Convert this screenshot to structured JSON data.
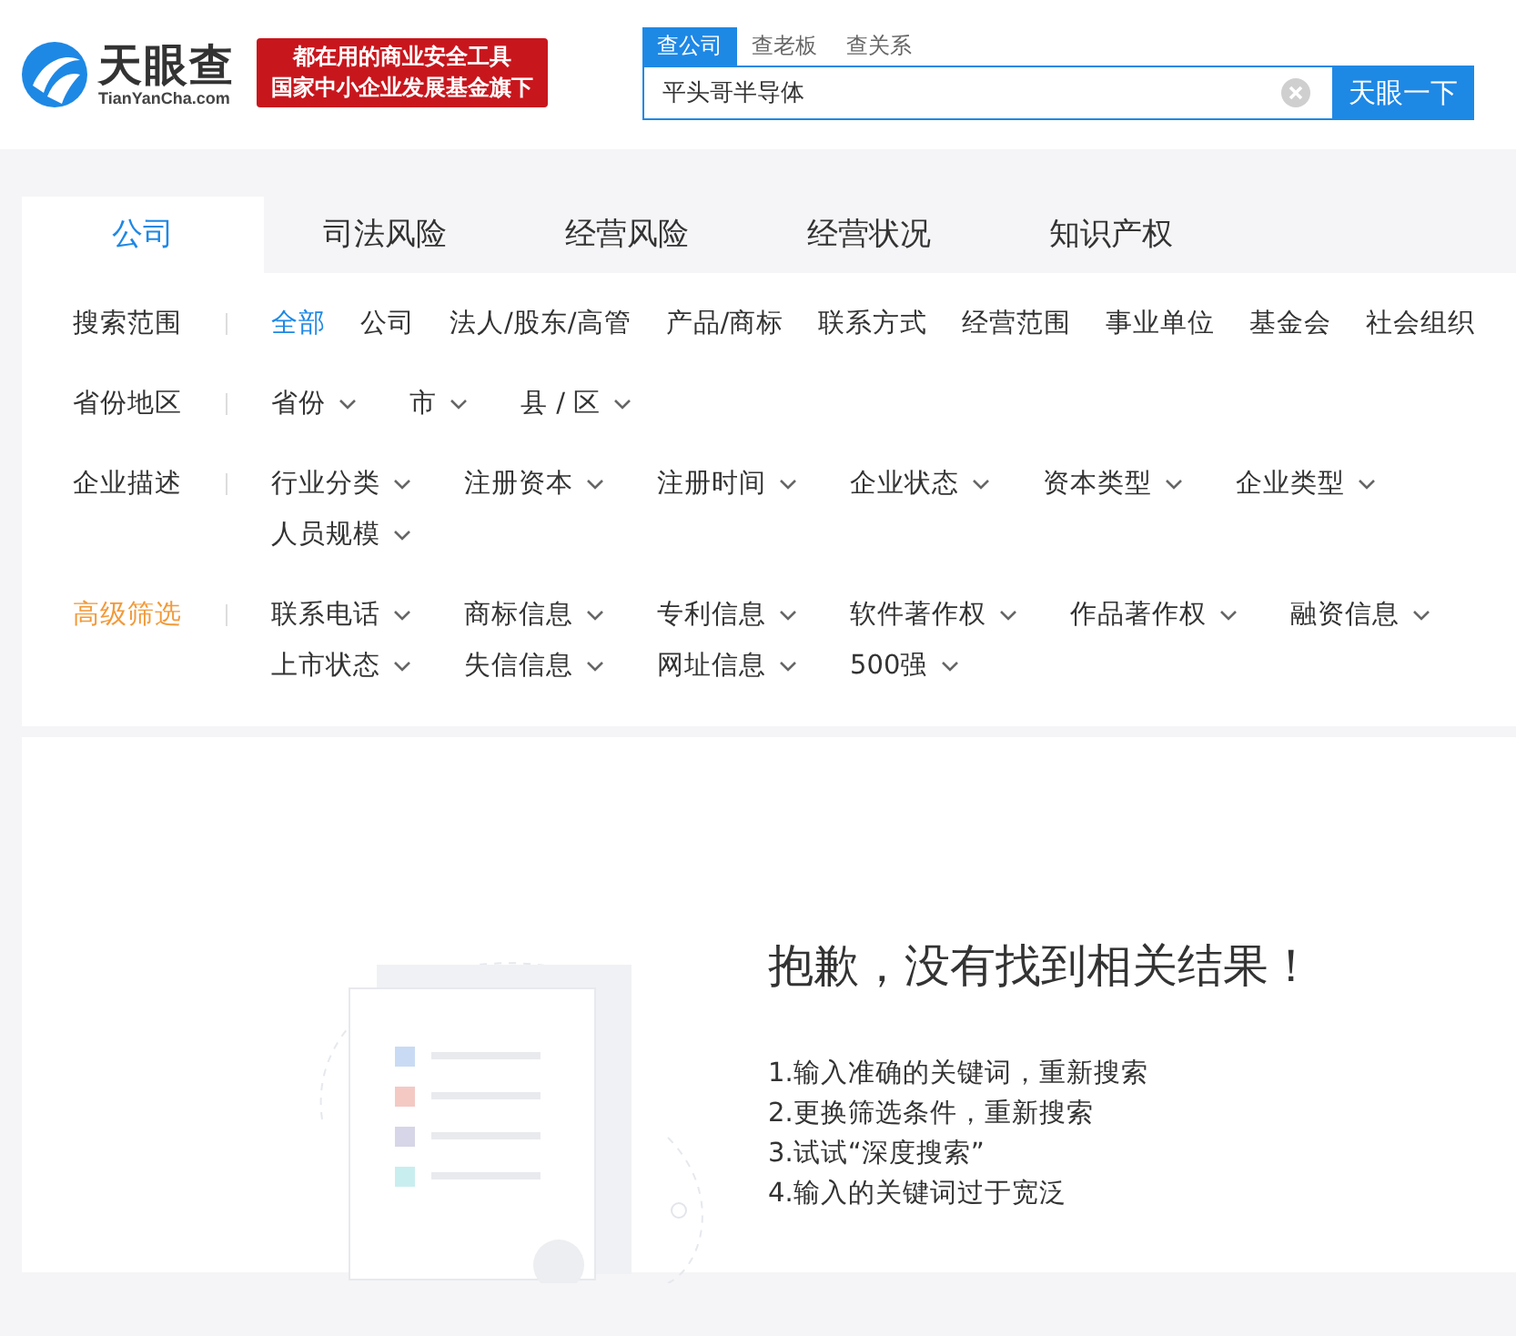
{
  "header": {
    "logo": {
      "name": "天眼查",
      "domain": "TianYanCha.com"
    },
    "banner": [
      "都在用的商业安全工具",
      "国家中小企业发展基金旗下"
    ],
    "search": {
      "tabs": [
        {
          "label": "查公司",
          "selected": true
        },
        {
          "label": "查老板",
          "selected": false
        },
        {
          "label": "查关系",
          "selected": false
        }
      ],
      "value": "平头哥半导体",
      "button": "天眼一下"
    }
  },
  "category_tabs": [
    {
      "label": "公司",
      "selected": true
    },
    {
      "label": "司法风险",
      "selected": false
    },
    {
      "label": "经营风险",
      "selected": false
    },
    {
      "label": "经营状况",
      "selected": false
    },
    {
      "label": "知识产权",
      "selected": false
    }
  ],
  "filters": [
    {
      "label": "搜索范围",
      "highlighted": false,
      "kind": "options",
      "items": [
        {
          "label": "全部",
          "selected": true
        },
        {
          "label": "公司",
          "selected": false
        },
        {
          "label": "法人/股东/高管",
          "selected": false
        },
        {
          "label": "产品/商标",
          "selected": false
        },
        {
          "label": "联系方式",
          "selected": false
        },
        {
          "label": "经营范围",
          "selected": false
        },
        {
          "label": "事业单位",
          "selected": false
        },
        {
          "label": "基金会",
          "selected": false
        },
        {
          "label": "社会组织",
          "selected": false
        }
      ]
    },
    {
      "label": "省份地区",
      "highlighted": false,
      "kind": "dropdowns",
      "items": [
        {
          "label": "省份"
        },
        {
          "label": "市"
        },
        {
          "label": "县 / 区"
        }
      ]
    },
    {
      "label": "企业描述",
      "highlighted": false,
      "kind": "dropdowns",
      "items": [
        {
          "label": "行业分类"
        },
        {
          "label": "注册资本"
        },
        {
          "label": "注册时间"
        },
        {
          "label": "企业状态"
        },
        {
          "label": "资本类型"
        },
        {
          "label": "企业类型"
        },
        {
          "label": "人员规模"
        }
      ]
    },
    {
      "label": "高级筛选",
      "highlighted": true,
      "kind": "dropdowns",
      "items": [
        {
          "label": "联系电话"
        },
        {
          "label": "商标信息"
        },
        {
          "label": "专利信息"
        },
        {
          "label": "软件著作权"
        },
        {
          "label": "作品著作权"
        },
        {
          "label": "融资信息"
        },
        {
          "label": "上市状态"
        },
        {
          "label": "失信信息"
        },
        {
          "label": "网址信息"
        },
        {
          "label": "500强"
        }
      ]
    }
  ],
  "empty_state": {
    "title": "抱歉，没有找到相关结果！",
    "tips": [
      "1.输入准确的关键词，重新搜索",
      "2.更换筛选条件，重新搜索",
      "3.试试“深度搜索”",
      "4.输入的关键词过于宽泛"
    ]
  }
}
